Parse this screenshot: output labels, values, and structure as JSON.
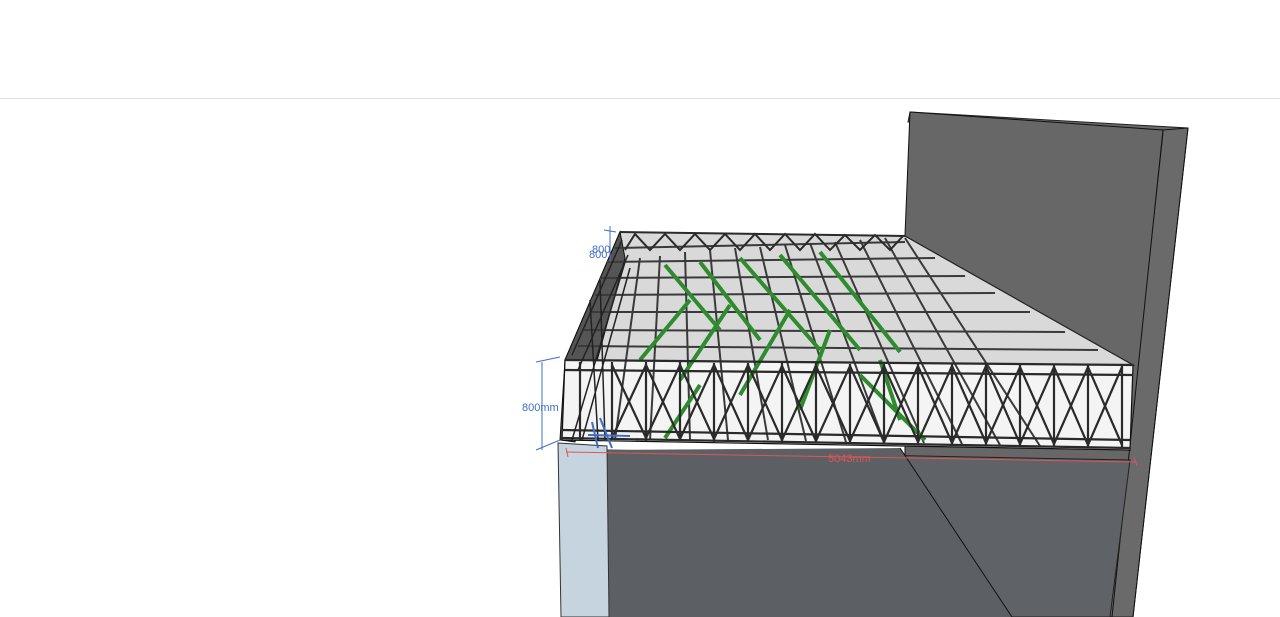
{
  "model_view": {
    "dimensions": {
      "height_left": "800mm",
      "height_top_a": "800",
      "height_top_b": "800",
      "length_front": "5043mm"
    },
    "colors": {
      "dimension_blue": "#3f6fc4",
      "dimension_red": "#e05555",
      "truss_green": "#2e8b2e",
      "wall_dark": "#6a6a6a",
      "floor_dark": "#5f6367",
      "column_light": "#c5d4de"
    }
  }
}
